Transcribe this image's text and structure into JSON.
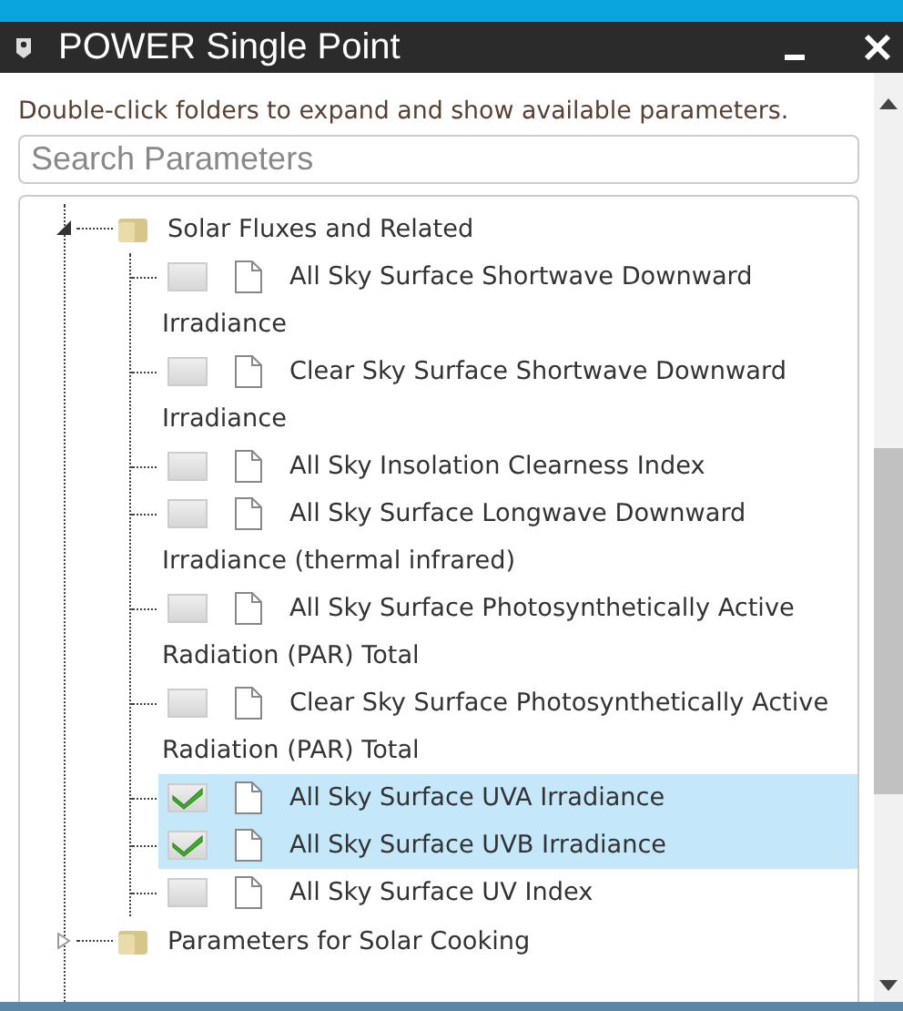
{
  "window": {
    "title": "POWER Single Point"
  },
  "instructions": "Double-click folders to expand and show available parameters.",
  "search": {
    "placeholder": "Search Parameters"
  },
  "tree": [
    {
      "label": "Solar Fluxes and Related",
      "expanded": true,
      "children": [
        {
          "label": "All Sky Surface Shortwave Downward Irradiance",
          "checked": false,
          "selected": false
        },
        {
          "label": "Clear Sky Surface Shortwave Downward Irradiance",
          "checked": false,
          "selected": false
        },
        {
          "label": "All Sky Insolation Clearness Index",
          "checked": false,
          "selected": false
        },
        {
          "label": "All Sky Surface Longwave Downward Irradiance (thermal infrared)",
          "checked": false,
          "selected": false
        },
        {
          "label": "All Sky Surface Photosynthetically Active Radiation (PAR) Total",
          "checked": false,
          "selected": false
        },
        {
          "label": "Clear Sky Surface Photosynthetically Active Radiation (PAR) Total",
          "checked": false,
          "selected": false
        },
        {
          "label": "All Sky Surface UVA Irradiance",
          "checked": true,
          "selected": true
        },
        {
          "label": "All Sky Surface UVB Irradiance",
          "checked": true,
          "selected": true
        },
        {
          "label": "All Sky Surface UV Index",
          "checked": false,
          "selected": false
        }
      ]
    },
    {
      "label": "Parameters for Solar Cooking",
      "expanded": false
    }
  ]
}
